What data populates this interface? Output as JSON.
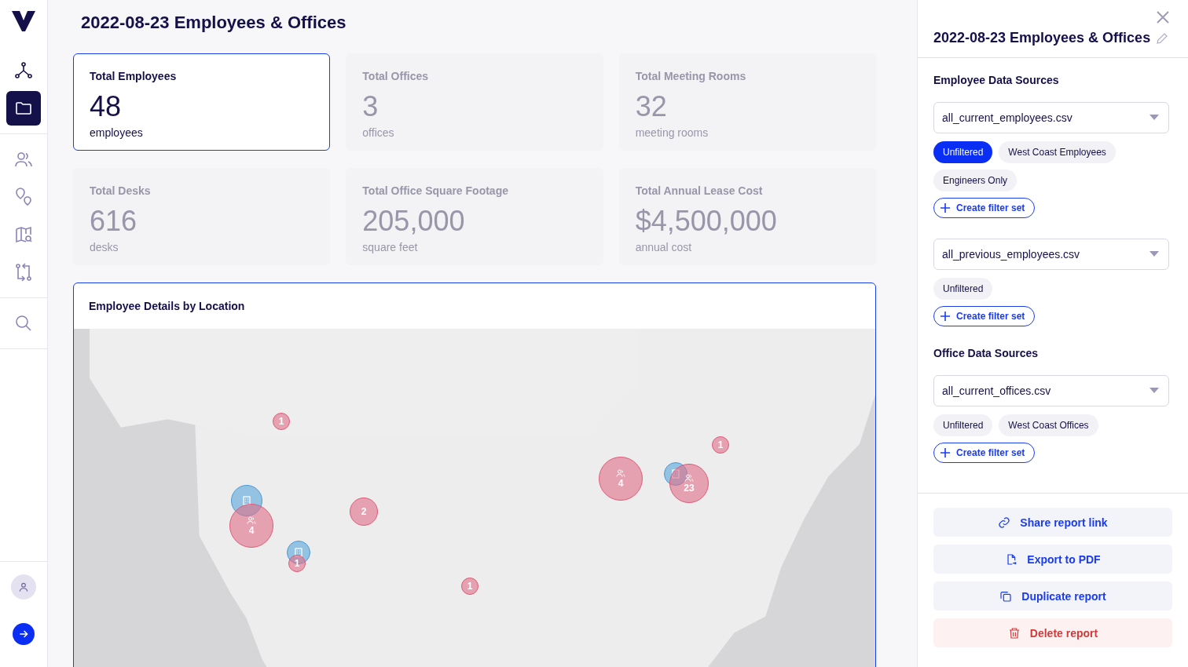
{
  "nav": {
    "groups": [
      [
        {
          "selected": false
        },
        {
          "selected": true
        }
      ],
      [
        {
          "selected": false
        },
        {
          "selected": false
        },
        {
          "selected": false
        },
        {
          "selected": false
        }
      ],
      [
        {
          "selected": false
        }
      ]
    ]
  },
  "title": "2022-08-23 Employees & Offices",
  "cards": [
    {
      "label": "Total Employees",
      "value": "48",
      "unit": "employees",
      "selected": true
    },
    {
      "label": "Total Offices",
      "value": "3",
      "unit": "offices",
      "selected": false
    },
    {
      "label": "Total Meeting Rooms",
      "value": "32",
      "unit": "meeting rooms",
      "selected": false
    },
    {
      "label": "Total Desks",
      "value": "616",
      "unit": "desks",
      "selected": false
    },
    {
      "label": "Total Office Square Footage",
      "value": "205,000",
      "unit": "square feet",
      "selected": false
    },
    {
      "label": "Total Annual Lease Cost",
      "value": "$4,500,000",
      "unit": "annual cost",
      "selected": false
    }
  ],
  "map_panel": {
    "title": "Employee Details by Location",
    "markers": [
      {
        "kind": "employees",
        "count": "1"
      },
      {
        "kind": "employees",
        "count": "2"
      },
      {
        "kind": "offices"
      },
      {
        "kind": "employees",
        "count": "4"
      },
      {
        "kind": "offices"
      },
      {
        "kind": "employees",
        "count": "1"
      },
      {
        "kind": "employees",
        "count": "1"
      },
      {
        "kind": "employees",
        "count": "4"
      },
      {
        "kind": "offices"
      },
      {
        "kind": "employees",
        "count": "23"
      },
      {
        "kind": "employees",
        "count": "1"
      }
    ]
  },
  "side_panel": {
    "title": "2022-08-23 Employees & Offices",
    "sections": [
      {
        "heading": "Employee Data Sources",
        "sources": [
          {
            "file": "all_current_employees.csv",
            "filters": [
              {
                "label": "Unfiltered",
                "selected": true
              },
              {
                "label": "West Coast Employees",
                "selected": false
              },
              {
                "label": "Engineers Only",
                "selected": false
              }
            ],
            "create": "Create filter set"
          },
          {
            "file": "all_previous_employees.csv",
            "filters": [
              {
                "label": "Unfiltered",
                "selected": false
              }
            ],
            "create": "Create filter set"
          }
        ]
      },
      {
        "heading": "Office Data Sources",
        "sources": [
          {
            "file": "all_current_offices.csv",
            "filters": [
              {
                "label": "Unfiltered",
                "selected": false
              },
              {
                "label": "West Coast Offices",
                "selected": false
              }
            ],
            "create": "Create filter set"
          }
        ]
      }
    ],
    "actions": [
      {
        "kind": "link",
        "label": "Share report link"
      },
      {
        "kind": "pdf",
        "label": "Export to PDF"
      },
      {
        "kind": "duplicate",
        "label": "Duplicate report"
      },
      {
        "kind": "delete",
        "label": "Delete report"
      }
    ]
  }
}
